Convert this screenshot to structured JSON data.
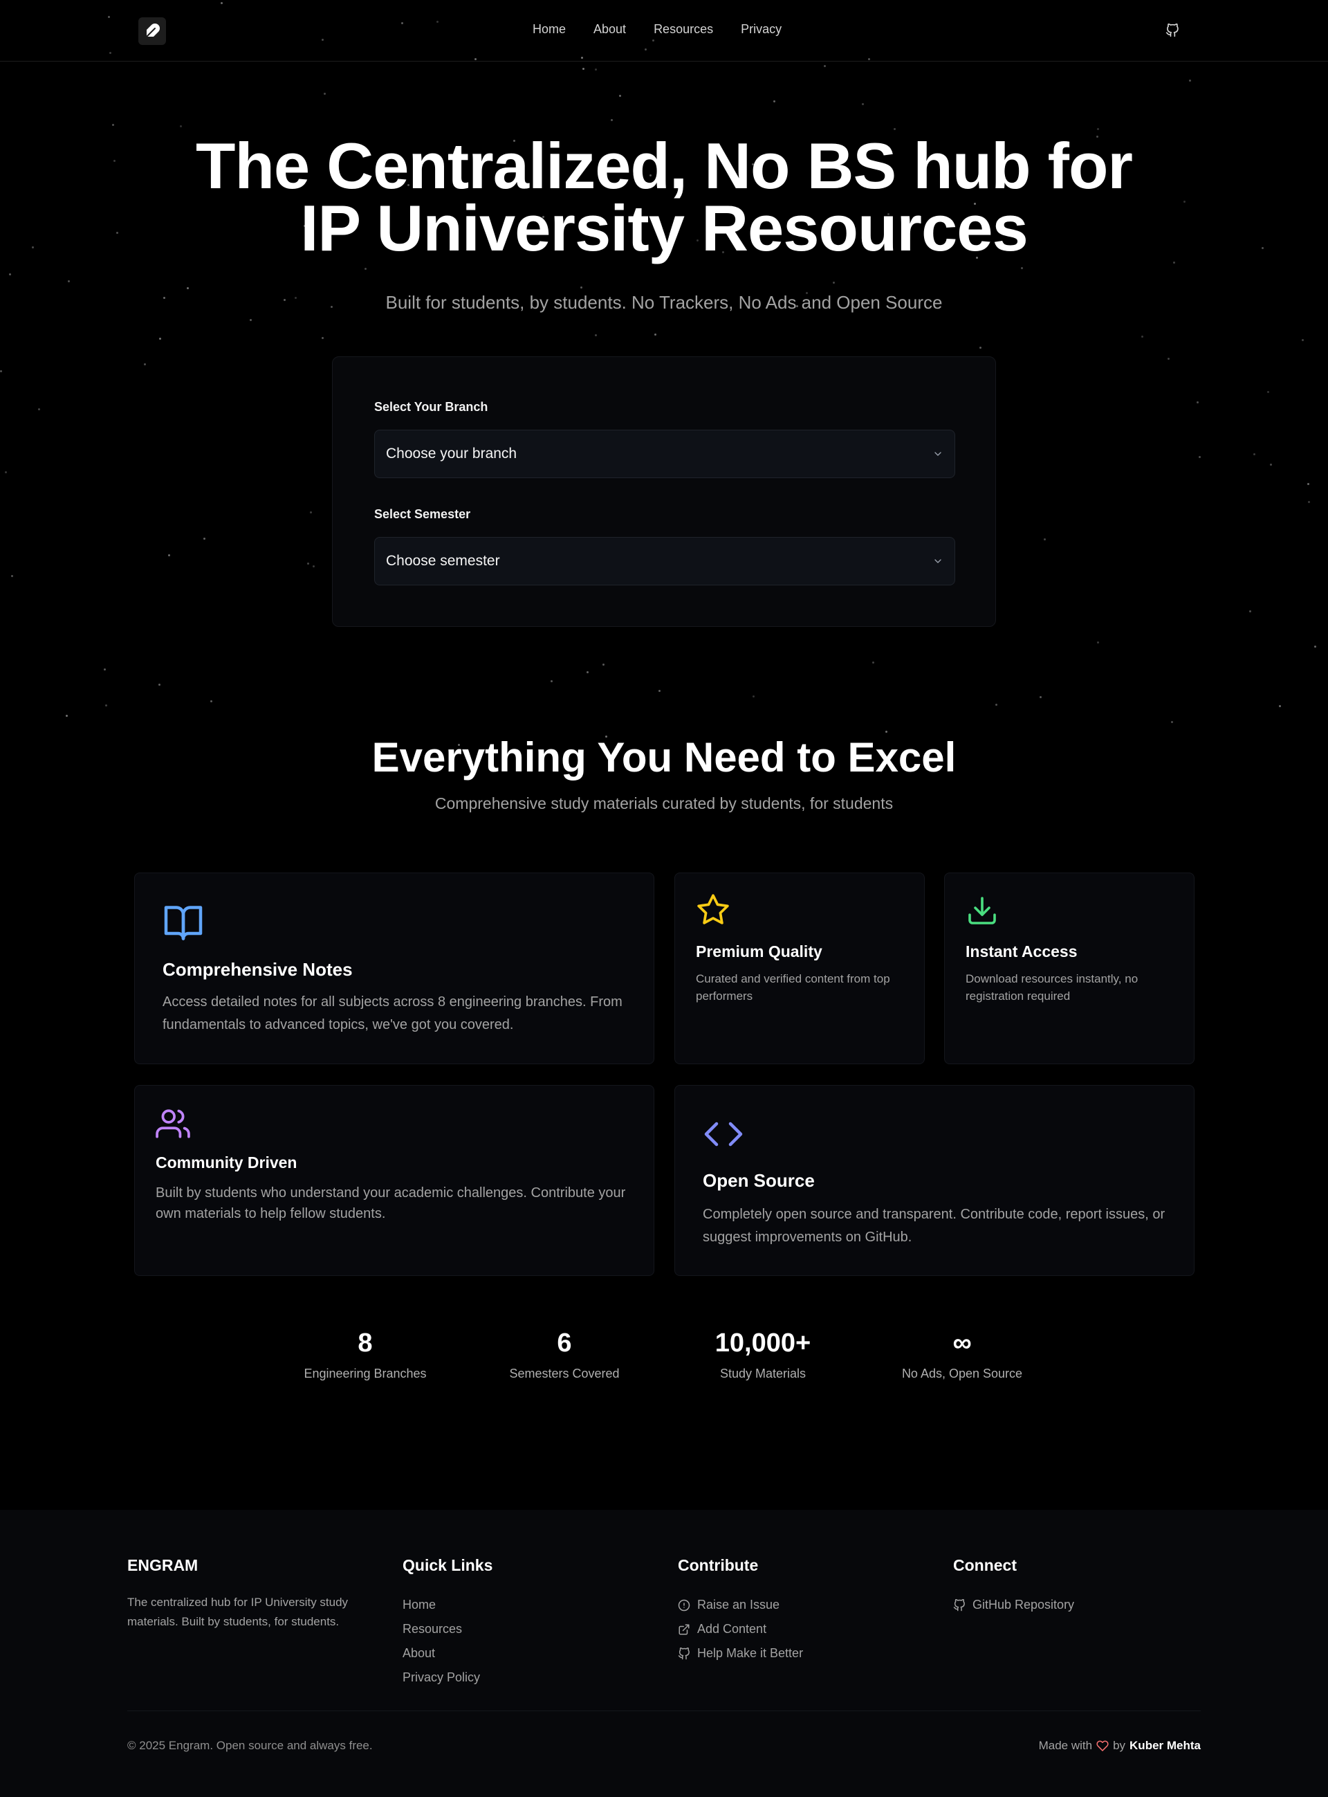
{
  "nav": {
    "logo_icon": "feather-icon",
    "links": [
      "Home",
      "About",
      "Resources",
      "Privacy"
    ],
    "github_icon": "github-icon"
  },
  "hero": {
    "title_line1": "The Centralized, No BS hub for",
    "title_line2": "IP University Resources",
    "subtitle": "Built for students, by students. No Trackers, No Ads and Open Source"
  },
  "selector": {
    "branch_label": "Select Your Branch",
    "branch_value": "Choose your branch",
    "semester_label": "Select Semester",
    "semester_value": "Choose semester"
  },
  "features": {
    "title": "Everything You Need to Excel",
    "subtitle": "Comprehensive study materials curated by students, for students",
    "cards": [
      {
        "icon": "book-open-icon",
        "title": "Comprehensive Notes",
        "desc": "Access detailed notes for all subjects across 8 engineering branches. From fundamentals to advanced topics, we've got you covered.",
        "color": "#60a5fa"
      },
      {
        "icon": "star-icon",
        "title": "Premium Quality",
        "desc": "Curated and verified content from top performers",
        "color": "#facc15"
      },
      {
        "icon": "download-icon",
        "title": "Instant Access",
        "desc": "Download resources instantly, no registration required",
        "color": "#4ade80"
      },
      {
        "icon": "users-icon",
        "title": "Community Driven",
        "desc": "Built by students who understand your academic challenges. Contribute your own materials to help fellow students.",
        "color": "#c084fc"
      },
      {
        "icon": "code-icon",
        "title": "Open Source",
        "desc": "Completely open source and transparent. Contribute code, report issues, or suggest improvements on GitHub.",
        "color": "#818cf8"
      }
    ]
  },
  "stats": [
    {
      "value": "8",
      "label": "Engineering Branches"
    },
    {
      "value": "6",
      "label": "Semesters Covered"
    },
    {
      "value": "10,000+",
      "label": "Study Materials"
    },
    {
      "value": "∞",
      "label": "No Ads, Open Source"
    }
  ],
  "footer": {
    "brand": "ENGRAM",
    "brand_desc": "The centralized hub for IP University study materials. Built by students, for students.",
    "quick_links_title": "Quick Links",
    "quick_links": [
      "Home",
      "Resources",
      "About",
      "Privacy Policy"
    ],
    "contribute_title": "Contribute",
    "contribute_links": [
      {
        "icon": "alert-circle-icon",
        "label": "Raise an Issue"
      },
      {
        "icon": "external-link-icon",
        "label": "Add Content"
      },
      {
        "icon": "github-icon",
        "label": "Help Make it Better"
      }
    ],
    "connect_title": "Connect",
    "connect_links": [
      {
        "icon": "github-icon",
        "label": "GitHub Repository"
      }
    ],
    "copyright": "© 2025 Engram. Open source and always free.",
    "made_with": "Made with",
    "by": "by",
    "author": "Kuber Mehta",
    "heart_color": "#f87171"
  }
}
